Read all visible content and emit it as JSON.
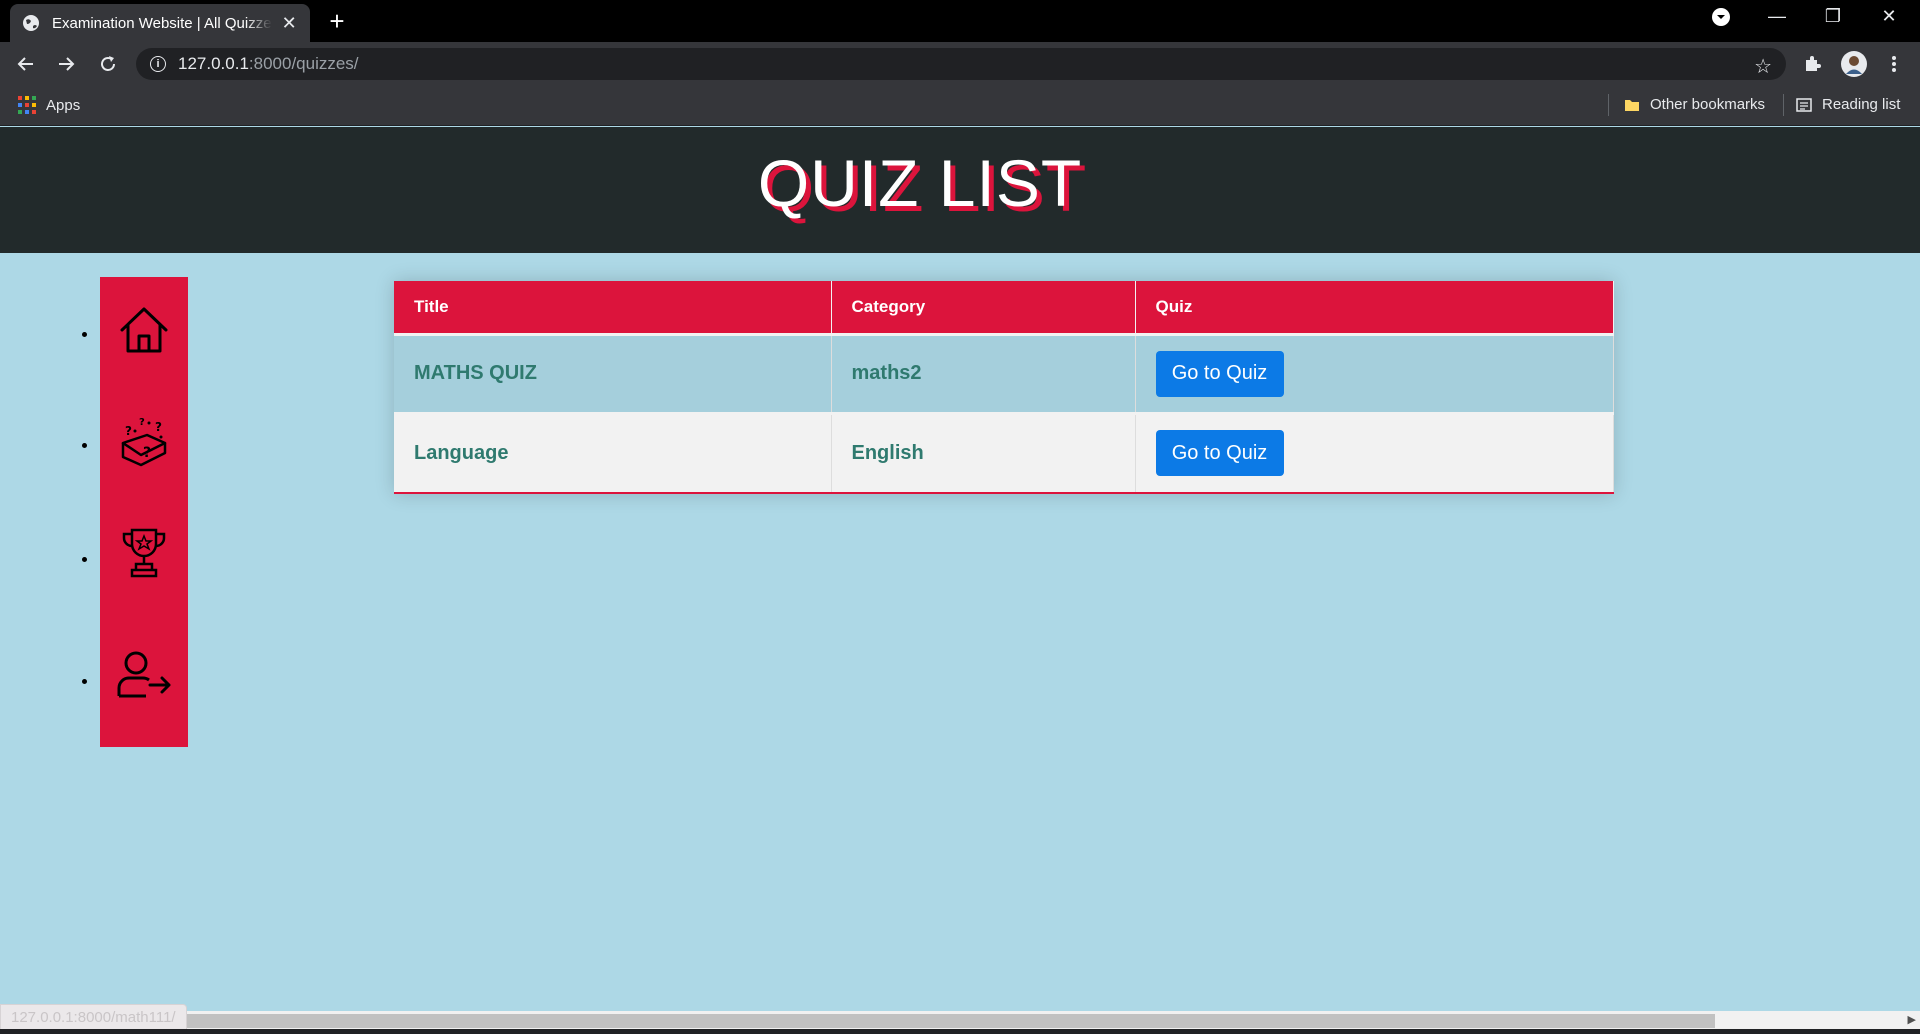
{
  "browser": {
    "tab_title": "Examination Website | All Quizzes",
    "tab_close": "✕",
    "new_tab": "+",
    "url_host": "127.0.0.1",
    "url_path": ":8000/quizzes/",
    "bookmarks": {
      "apps": "Apps",
      "other": "Other bookmarks",
      "reading": "Reading list"
    },
    "window_controls": {
      "minimize": "—",
      "restore": "❐",
      "close": "✕"
    }
  },
  "header": {
    "title": "QUIZ LIST"
  },
  "sidebar": {
    "items": [
      {
        "name": "home",
        "icon": "home-icon"
      },
      {
        "name": "quizzes",
        "icon": "quiz-box-icon"
      },
      {
        "name": "results",
        "icon": "trophy-icon"
      },
      {
        "name": "logout",
        "icon": "logout-icon"
      }
    ]
  },
  "table": {
    "columns": [
      "Title",
      "Category",
      "Quiz"
    ],
    "rows": [
      {
        "title": "MATHS QUIZ",
        "category": "maths2",
        "action": "Go to Quiz"
      },
      {
        "title": "Language",
        "category": "English",
        "action": "Go to Quiz"
      }
    ]
  },
  "status_url": "127.0.0.1:8000/math111/",
  "colors": {
    "accent": "#dc143c",
    "page_bg": "#add8e6",
    "header_bg": "#222a2b",
    "button": "#0c7ae6",
    "cell_text": "#2f7a6f"
  }
}
